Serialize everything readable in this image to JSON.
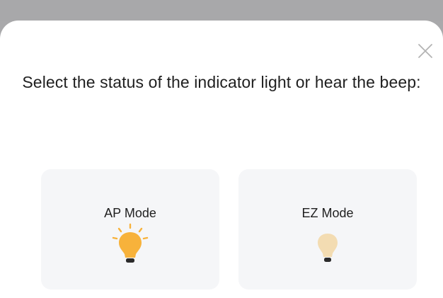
{
  "dialog": {
    "title": "Select the status of the indicator light or hear the beep:",
    "close_icon": "close-icon"
  },
  "modes": [
    {
      "label": "AP Mode",
      "icon": "bulb-blinking-icon",
      "bulb_color": "#f7b23b"
    },
    {
      "label": "EZ Mode",
      "icon": "bulb-dim-icon",
      "bulb_color": "#f3dcb2"
    }
  ],
  "colors": {
    "backdrop": "#a9a9ab",
    "sheet": "#ffffff",
    "card": "#f5f6f8",
    "text": "#1f1f1f"
  }
}
